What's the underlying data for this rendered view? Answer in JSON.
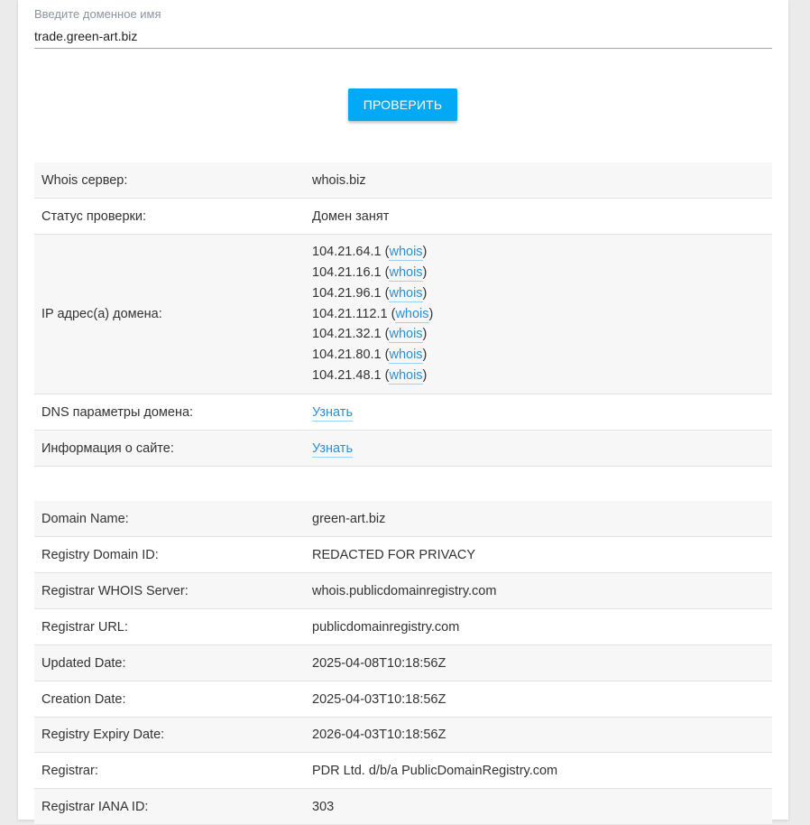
{
  "search": {
    "label": "Введите доменное имя",
    "value": "trade.green-art.biz",
    "button_label": "ПРОВЕРИТЬ"
  },
  "status_table": {
    "whois_server": {
      "key": "Whois сервер:",
      "value": "whois.biz"
    },
    "check_status": {
      "key": "Статус проверки:",
      "value": "Домен занят"
    },
    "ip": {
      "key": "IP адрес(а) домена:",
      "link_text": "whois",
      "addresses": [
        "104.21.64.1",
        "104.21.16.1",
        "104.21.96.1",
        "104.21.112.1",
        "104.21.32.1",
        "104.21.80.1",
        "104.21.48.1"
      ]
    },
    "dns": {
      "key": "DNS параметры домена:",
      "link": "Узнать"
    },
    "site_info": {
      "key": "Информация о сайте:",
      "link": "Узнать"
    }
  },
  "whois_table": [
    {
      "key": "Domain Name:",
      "value": "green-art.biz"
    },
    {
      "key": "Registry Domain ID:",
      "value": "REDACTED FOR PRIVACY"
    },
    {
      "key": "Registrar WHOIS Server:",
      "value": "whois.publicdomainregistry.com"
    },
    {
      "key": "Registrar URL:",
      "value": "publicdomainregistry.com"
    },
    {
      "key": "Updated Date:",
      "value": "2025-04-08T10:18:56Z"
    },
    {
      "key": "Creation Date:",
      "value": "2025-04-03T10:18:56Z"
    },
    {
      "key": "Registry Expiry Date:",
      "value": "2026-04-03T10:18:56Z"
    },
    {
      "key": "Registrar:",
      "value": "PDR Ltd. d/b/a PublicDomainRegistry.com"
    },
    {
      "key": "Registrar IANA ID:",
      "value": "303"
    }
  ],
  "colors": {
    "accent": "#03a9f4",
    "link": "#2a8fd6",
    "row_alt": "#f7f7f7",
    "page_bg": "#ebebeb"
  }
}
